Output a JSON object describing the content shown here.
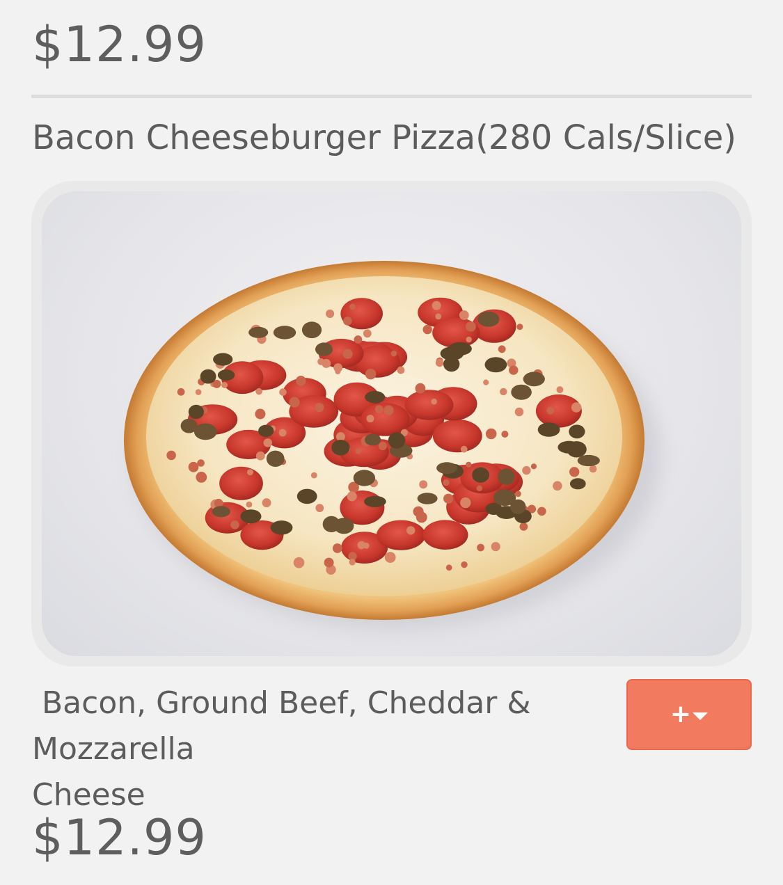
{
  "item": {
    "price_top": "$12.99",
    "title": "Bacon Cheeseburger Pizza(280 Cals/Slice)",
    "image_alt": "pizza-photo",
    "description": " Bacon, Ground Beef, Cheddar & Mozzarella\nCheese",
    "add_button_plus": "+",
    "add_button_icon": "caret-down-icon",
    "price_bottom": "$12.99"
  },
  "colors": {
    "background": "#f2f2f2",
    "accent_button": "#f27a5e",
    "text": "#5c5c5c",
    "divider": "#dcdcdc"
  }
}
